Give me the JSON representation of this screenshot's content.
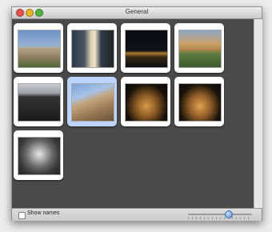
{
  "window": {
    "title": "General"
  },
  "footer": {
    "show_names_label": "Show names",
    "size_slider_value": 0.62
  },
  "thumbnails": [
    {
      "name": "thumb-pisa-cathedral",
      "icon": "photo-icon",
      "selected": false
    },
    {
      "name": "thumb-leaning-tower",
      "icon": "photo-icon",
      "selected": false
    },
    {
      "name": "thumb-night-bridge",
      "icon": "photo-icon",
      "selected": false
    },
    {
      "name": "thumb-ponte-vecchio",
      "icon": "photo-icon",
      "selected": false
    },
    {
      "name": "thumb-colosseum-interior",
      "icon": "photo-icon",
      "selected": false
    },
    {
      "name": "thumb-colosseum-arches",
      "icon": "photo-icon",
      "selected": true
    },
    {
      "name": "thumb-colosseum-night-1",
      "icon": "photo-icon",
      "selected": false
    },
    {
      "name": "thumb-colosseum-night-2",
      "icon": "photo-icon",
      "selected": false
    },
    {
      "name": "thumb-dome-interior",
      "icon": "photo-icon",
      "selected": false
    }
  ]
}
